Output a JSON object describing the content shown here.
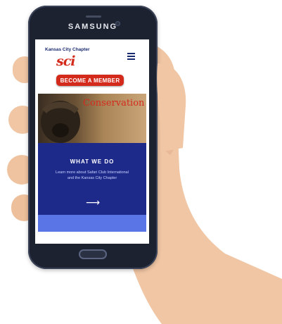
{
  "device": {
    "brand": "SAMSUNG"
  },
  "header": {
    "chapter_name": "Kansas City Chapter",
    "logo_text": "sci",
    "menu_icon": "hamburger-menu-icon"
  },
  "cta": {
    "member_label": "BECOME A MEMBER"
  },
  "hero": {
    "title": "Conservation"
  },
  "what_we_do": {
    "heading": "WHAT WE DO",
    "text": "Learn more about Safari Club International and the Kansas City Chapter",
    "arrow_icon": "right-arrow-icon"
  },
  "colors": {
    "brand_red": "#d42a1c",
    "navy": "#1d2a8a",
    "light_blue": "#5a75e6"
  }
}
